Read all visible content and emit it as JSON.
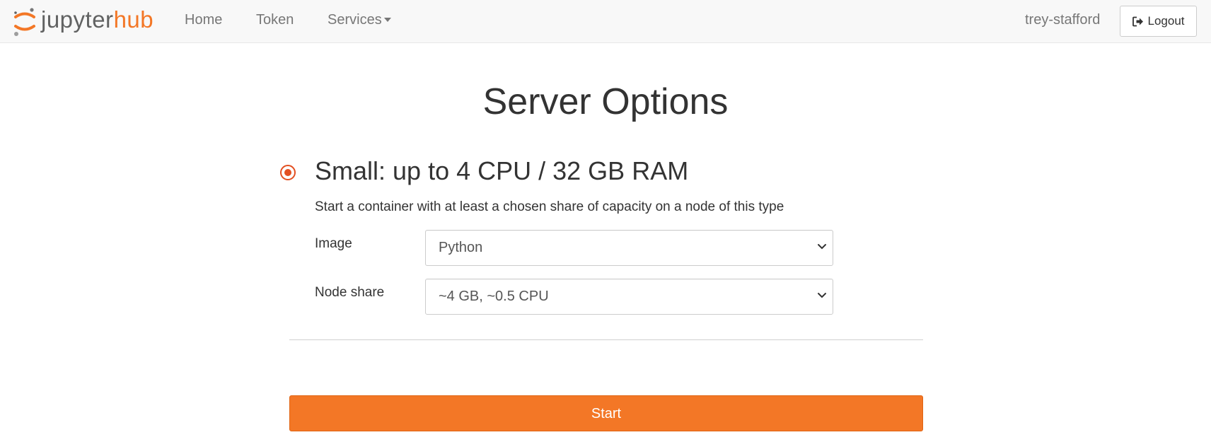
{
  "navbar": {
    "brand": {
      "part1": "jupyter",
      "part2": "hub"
    },
    "links": [
      {
        "label": "Home"
      },
      {
        "label": "Token"
      },
      {
        "label": "Services"
      }
    ],
    "user": "trey-stafford",
    "logout_label": "Logout"
  },
  "main": {
    "title": "Server Options",
    "profile": {
      "name": "Small: up to 4 CPU / 32 GB RAM",
      "description": "Start a container with at least a chosen share of capacity on a node of this type",
      "selected": true,
      "options": [
        {
          "label": "Image",
          "value": "Python"
        },
        {
          "label": "Node share",
          "value": "~4 GB, ~0.5 CPU"
        }
      ]
    },
    "start_label": "Start"
  },
  "colors": {
    "accent": "#f37726",
    "radio": "#e34f21",
    "navbar_bg": "#f8f8f8",
    "brand_gray": "#616262"
  },
  "icons": {
    "brand": "jupyter-logo-icon",
    "services_dropdown": "caret-down-icon",
    "logout": "sign-out-icon",
    "select": "chevron-down-icon"
  }
}
